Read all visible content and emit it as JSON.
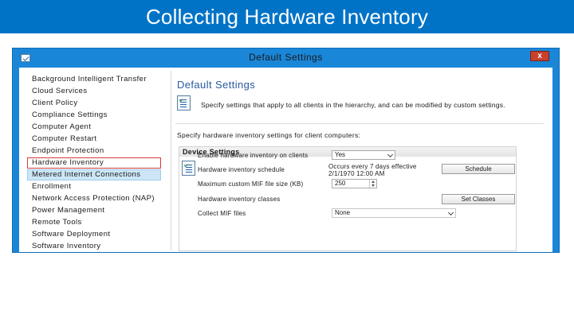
{
  "slide": {
    "title": "Collecting Hardware Inventory"
  },
  "window": {
    "title": "Default Settings",
    "close_label": "x"
  },
  "sidebar": {
    "items": [
      {
        "label": "Background Intelligent Transfer"
      },
      {
        "label": "Cloud Services"
      },
      {
        "label": "Client Policy"
      },
      {
        "label": "Compliance Settings"
      },
      {
        "label": "Computer Agent"
      },
      {
        "label": "Computer Restart"
      },
      {
        "label": "Endpoint Protection"
      },
      {
        "label": "Hardware Inventory"
      },
      {
        "label": "Metered Internet Connections"
      },
      {
        "label": "Enrollment"
      },
      {
        "label": "Network Access Protection (NAP)"
      },
      {
        "label": "Power Management"
      },
      {
        "label": "Remote Tools"
      },
      {
        "label": "Software Deployment"
      },
      {
        "label": "Software Inventory"
      }
    ],
    "selected": "Hardware Inventory"
  },
  "main": {
    "heading": "Default Settings",
    "description": "Specify settings that apply to all clients in the hierarchy, and can be modified by custom settings.",
    "specify_text": "Specify hardware inventory settings for client computers:",
    "group": {
      "title": "Device Settings",
      "rows": {
        "enable": {
          "label": "Enable hardware inventory on clients",
          "value": "Yes"
        },
        "schedule": {
          "label": "Hardware inventory schedule",
          "value_line1": "Occurs every 7 days effective",
          "value_line2": "2/1/1970 12:00 AM",
          "button": "Schedule"
        },
        "mif_size": {
          "label": "Maximum custom MIF file size (KB)",
          "value": "250"
        },
        "classes": {
          "label": "Hardware inventory classes",
          "button": "Set Classes"
        },
        "collect_mif": {
          "label": "Collect MIF files",
          "value": "None"
        }
      }
    }
  },
  "colors": {
    "title_bar": "#0173c7",
    "window_frame": "#1a86d8",
    "selection_border": "#d93a3a",
    "hover_bg": "#cde6f7",
    "heading": "#2a5aa0"
  }
}
